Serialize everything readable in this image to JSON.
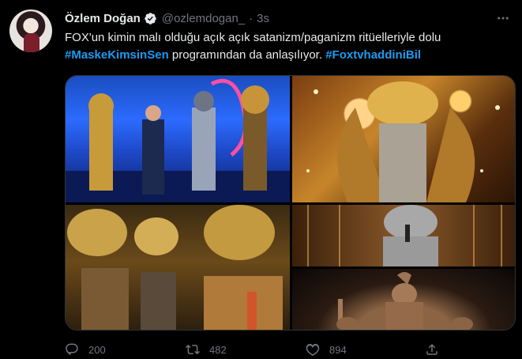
{
  "author": {
    "name": "Özlem Doğan",
    "handle": "@ozlemdogan_",
    "separator": "·",
    "time": "3s"
  },
  "tweet": {
    "line1": "FOX'un kimin malı olduğu açık açık satanizm/paganizm ritüelleriyle dolu",
    "hashtag1": "#MaskeKimsinSen",
    "line2_mid": " programından da anlaşılıyor. ",
    "hashtag2": "#FoxtvhaddiniBil"
  },
  "media": {
    "images": [
      "grid-image-stage",
      "grid-image-golden-costume",
      "grid-image-masks",
      "grid-image-silver-costume",
      "grid-image-statue"
    ]
  },
  "actions": {
    "replies": "200",
    "retweets": "482",
    "likes": "894"
  },
  "colors": {
    "background": "#000000",
    "text": "#e7e9ea",
    "muted": "#71767b",
    "link": "#1d9bf0",
    "verified": "#e7e9ea"
  },
  "icons": [
    "verified-badge-icon",
    "more-icon",
    "reply-icon",
    "retweet-icon",
    "like-icon",
    "share-icon"
  ]
}
